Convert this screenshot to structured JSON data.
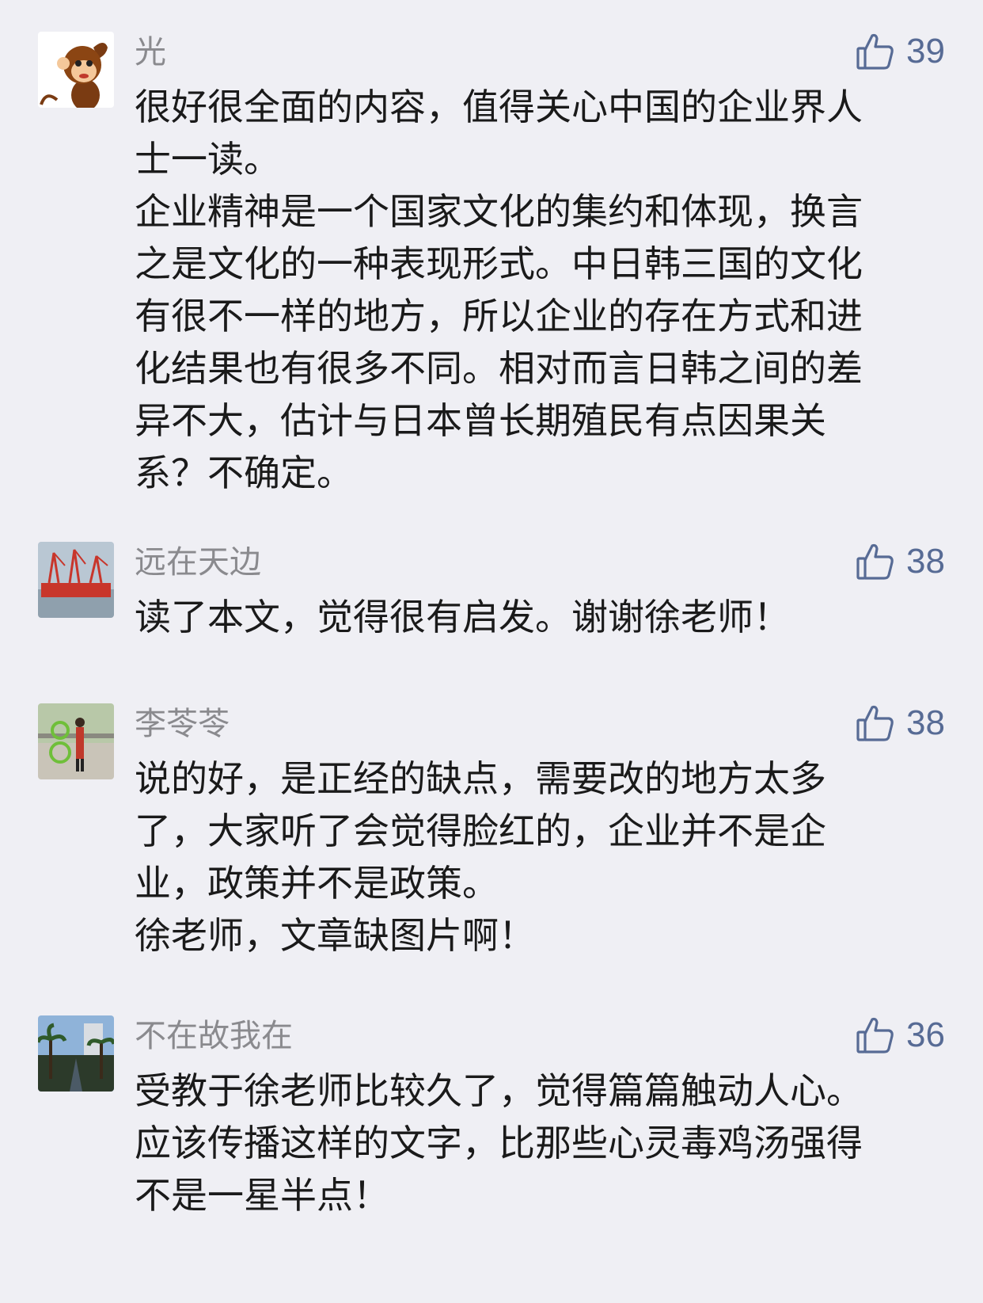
{
  "comments": [
    {
      "author": "光",
      "likes": "39",
      "avatar_icon": "monkey-avatar",
      "paragraphs": [
        "很好很全面的内容，值得关心中国的企业界人\n士一读。",
        "企业精神是一个国家文化的集约和体现，换言\n之是文化的一种表现形式。中日韩三国的文化\n有很不一样的地方，所以企业的存在方式和进\n化结果也有很多不同。相对而言日韩之间的差\n异不大，估计与日本曾长期殖民有点因果关\n系？不确定。"
      ]
    },
    {
      "author": "远在天边",
      "likes": "38",
      "avatar_icon": "ship-cranes-avatar",
      "paragraphs": [
        "读了本文，觉得很有启发。谢谢徐老师！"
      ]
    },
    {
      "author": "李苓苓",
      "likes": "38",
      "avatar_icon": "cyclist-avatar",
      "paragraphs": [
        "说的好，是正经的缺点，需要改的地方太多\n了，大家听了会觉得脸红的，企业并不是企\n业，政策并不是政策。",
        "徐老师，文章缺图片啊！"
      ]
    },
    {
      "author": "不在故我在",
      "likes": "36",
      "avatar_icon": "palm-street-avatar",
      "paragraphs": [
        "受教于徐老师比较久了，觉得篇篇触动人心。\n应该传播这样的文字，比那些心灵毒鸡汤强得\n不是一星半点！"
      ]
    }
  ],
  "colors": {
    "background": "#efeff4",
    "author": "#8a8a8e",
    "like": "#576b95",
    "text": "#1a1a1a"
  }
}
